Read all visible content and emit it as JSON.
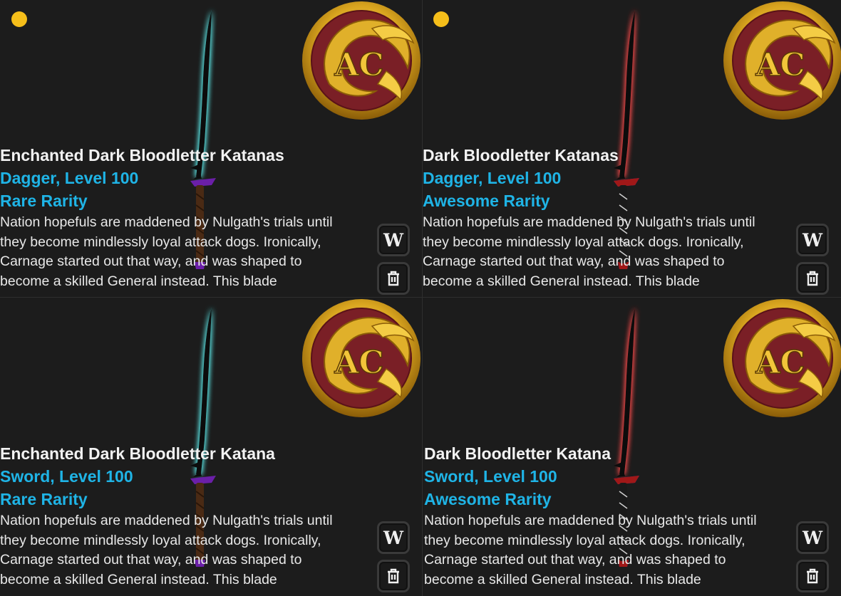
{
  "colors": {
    "background": "#1c1c1c",
    "title": "#f2f2f2",
    "subtitle": "#1fb4e6",
    "description": "#e8e8e8",
    "badge_dot": "#f5be1a",
    "coin_gold": "#d4a520",
    "coin_red": "#7a1f26",
    "enchanted_glow": "#5ff0f0",
    "regular_glow": "#ff4c4c"
  },
  "items": [
    {
      "title": "Enchanted Dark Bloodletter Katanas",
      "type_level": "Dagger, Level 100",
      "rarity": "Rare Rarity",
      "description": [
        "Nation hopefuls are maddened by Nulgath's trials until",
        "they become mindlessly loyal attack dogs. Ironically,",
        "Carnage started out that way, and was shaped to",
        "become a skilled General instead. This blade"
      ],
      "wear_label": "W",
      "icons": [
        "legend-coin-icon",
        "katana-icon",
        "wear-icon",
        "trash-icon"
      ],
      "glow": "enchanted"
    },
    {
      "title": "Dark Bloodletter Katanas",
      "type_level": "Dagger, Level 100",
      "rarity": "Awesome Rarity",
      "description": [
        "Nation hopefuls are maddened by Nulgath's trials until",
        "they become mindlessly loyal attack dogs. Ironically,",
        "Carnage started out that way, and was shaped to",
        "become a skilled General instead. This blade"
      ],
      "wear_label": "W",
      "icons": [
        "legend-coin-icon",
        "katana-icon",
        "wear-icon",
        "trash-icon"
      ],
      "glow": "regular"
    },
    {
      "title": "Enchanted Dark Bloodletter Katana",
      "type_level": "Sword, Level 100",
      "rarity": "Rare Rarity",
      "description": [
        "Nation hopefuls are maddened by Nulgath's trials until",
        "they become mindlessly loyal attack dogs. Ironically,",
        "Carnage started out that way, and was shaped to",
        "become a skilled General instead. This blade"
      ],
      "wear_label": "W",
      "icons": [
        "legend-coin-icon",
        "katana-icon",
        "wear-icon",
        "trash-icon"
      ],
      "glow": "enchanted"
    },
    {
      "title": "Dark Bloodletter Katana",
      "type_level": "Sword, Level 100",
      "rarity": "Awesome Rarity",
      "description": [
        "Nation hopefuls are maddened by Nulgath's trials until",
        "they become mindlessly loyal attack dogs. Ironically,",
        "Carnage started out that way, and was shaped to",
        "become a skilled General instead. This blade"
      ],
      "wear_label": "W",
      "icons": [
        "legend-coin-icon",
        "katana-icon",
        "wear-icon",
        "trash-icon"
      ],
      "glow": "regular"
    }
  ]
}
